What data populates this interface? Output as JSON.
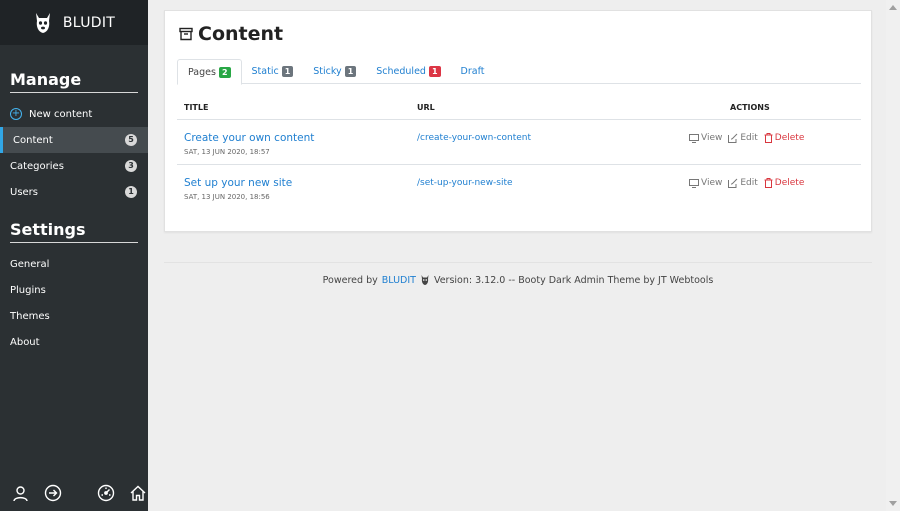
{
  "brand": {
    "name": "BLUDIT"
  },
  "sidebar": {
    "manage_title": "Manage",
    "manage_items": [
      {
        "label": "New content",
        "icon": "plus-circle-icon"
      },
      {
        "label": "Content",
        "badge": "5"
      },
      {
        "label": "Categories",
        "badge": "3"
      },
      {
        "label": "Users",
        "badge": "1"
      }
    ],
    "settings_title": "Settings",
    "settings_items": [
      {
        "label": "General"
      },
      {
        "label": "Plugins"
      },
      {
        "label": "Themes"
      },
      {
        "label": "About"
      }
    ],
    "footer_icons": [
      "user-icon",
      "logout-icon",
      "dashboard-icon",
      "home-icon"
    ]
  },
  "main": {
    "title": "Content",
    "tabs": [
      {
        "label": "Pages",
        "badge": "2",
        "badge_color": "#28a745"
      },
      {
        "label": "Static",
        "badge": "1",
        "badge_color": "#6c757d"
      },
      {
        "label": "Sticky",
        "badge": "1",
        "badge_color": "#6c757d"
      },
      {
        "label": "Scheduled",
        "badge": "1",
        "badge_color": "#dc3545"
      },
      {
        "label": "Draft"
      }
    ],
    "table": {
      "headers": {
        "title": "TITLE",
        "url": "URL",
        "actions": "ACTIONS"
      },
      "rows": [
        {
          "title": "Create your own content",
          "date": "SAT, 13 JUN 2020, 18:57",
          "url": "/create-your-own-content"
        },
        {
          "title": "Set up your new site",
          "date": "SAT, 13 JUN 2020, 18:56",
          "url": "/set-up-your-new-site"
        }
      ],
      "actions": {
        "view": "View",
        "edit": "Edit",
        "delete": "Delete"
      }
    }
  },
  "footer": {
    "powered_by": "Powered by",
    "link": "BLUDIT",
    "version_text": "Version: 3.12.0 -- Booty Dark Admin Theme by JT Webtools"
  },
  "colors": {
    "sidebar_bg": "#2b3033",
    "accent": "#1f7fd0",
    "active_border": "#31a7e7",
    "danger": "#d9363e"
  }
}
